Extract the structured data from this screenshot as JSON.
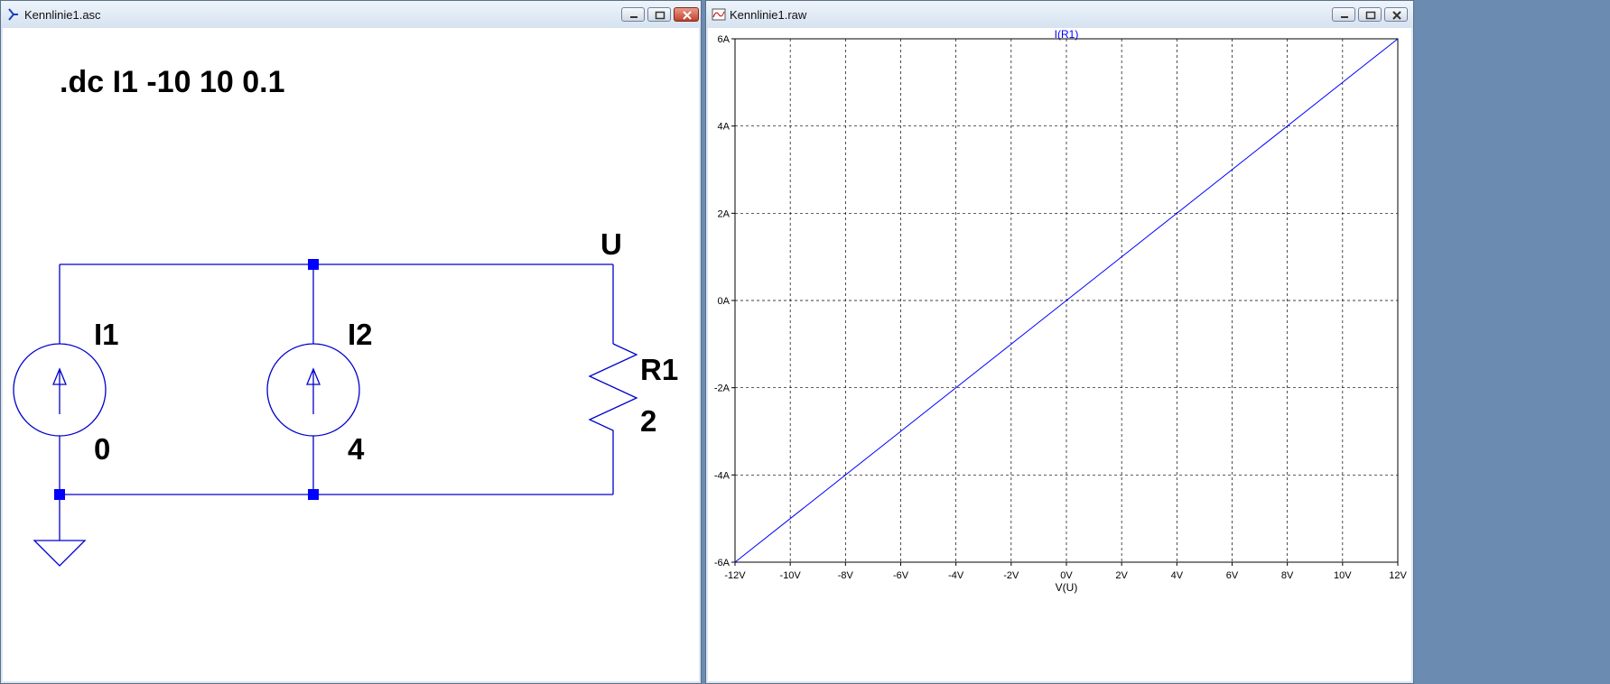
{
  "schematic_window": {
    "title": "Kennlinie1.asc",
    "directive": ".dc I1 -10 10 0.1",
    "net_label": "U",
    "components": {
      "i1": {
        "name": "I1",
        "value": "0"
      },
      "i2": {
        "name": "I2",
        "value": "4"
      },
      "r1": {
        "name": "R1",
        "value": "2"
      }
    }
  },
  "plot_window": {
    "title": "Kennlinie1.raw",
    "trace_label": "I(R1)",
    "x_axis_label": "V(U)",
    "x_ticks": [
      "-12V",
      "-10V",
      "-8V",
      "-6V",
      "-4V",
      "-2V",
      "0V",
      "2V",
      "4V",
      "6V",
      "8V",
      "10V",
      "12V"
    ],
    "y_ticks": [
      "6A",
      "4A",
      "2A",
      "0A",
      "-2A",
      "-4A",
      "-6A"
    ]
  },
  "chart_data": {
    "type": "line",
    "title": "I(R1)",
    "xlabel": "V(U)",
    "ylabel": "",
    "xlim": [
      -12,
      12
    ],
    "ylim": [
      -6,
      6
    ],
    "grid": true,
    "series": [
      {
        "name": "I(R1)",
        "color": "#0000ff",
        "x": [
          -12,
          0,
          12
        ],
        "y": [
          -6,
          0,
          6
        ]
      }
    ]
  },
  "colors": {
    "wire": "#0000cd",
    "junction": "#0000ff",
    "trace": "#0000ff",
    "grid": "#000000",
    "window_frame": "#dbe6f3"
  },
  "icons": {
    "minimize": "minimize-icon",
    "maximize": "maximize-icon",
    "close": "close-icon"
  }
}
